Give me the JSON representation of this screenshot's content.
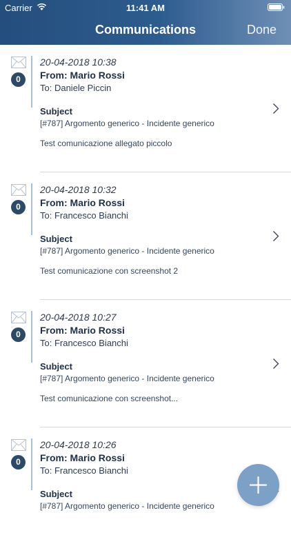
{
  "status_bar": {
    "carrier": "Carrier",
    "time": "11:41 AM"
  },
  "nav": {
    "title": "Communications",
    "done_label": "Done"
  },
  "communications": [
    {
      "count": "0",
      "date": "20-04-2018 10:38",
      "from": "From: Mario Rossi",
      "to": "To: Daniele Piccin",
      "subject_label": "Subject",
      "subject": "[#787] Argomento generico - Incidente generico",
      "body": "Test comunicazione allegato piccolo"
    },
    {
      "count": "0",
      "date": "20-04-2018 10:32",
      "from": "From: Mario Rossi",
      "to": "To: Francesco Bianchi",
      "subject_label": "Subject",
      "subject": "[#787] Argomento generico - Incidente generico",
      "body": "Test comunicazione con screenshot 2"
    },
    {
      "count": "0",
      "date": "20-04-2018 10:27",
      "from": "From: Mario Rossi",
      "to": "To: Francesco Bianchi",
      "subject_label": "Subject",
      "subject": "[#787] Argomento generico - Incidente generico",
      "body": "Test comunicazione con screenshot..."
    },
    {
      "count": "0",
      "date": "20-04-2018 10:26",
      "from": "From: Mario Rossi",
      "to": "To: Francesco Bianchi",
      "subject_label": "Subject",
      "subject": "[#787] Argomento generico - Incidente generico",
      "body": ""
    }
  ],
  "icons": {
    "envelope": "envelope-icon",
    "chevron": "chevron-right-icon",
    "add": "plus-icon",
    "wifi": "wifi-icon",
    "battery": "battery-icon"
  },
  "colors": {
    "header_start": "#244e7c",
    "header_end": "#6f8fb6",
    "badge": "#2c4a68",
    "fab": "#7ca0c6"
  }
}
